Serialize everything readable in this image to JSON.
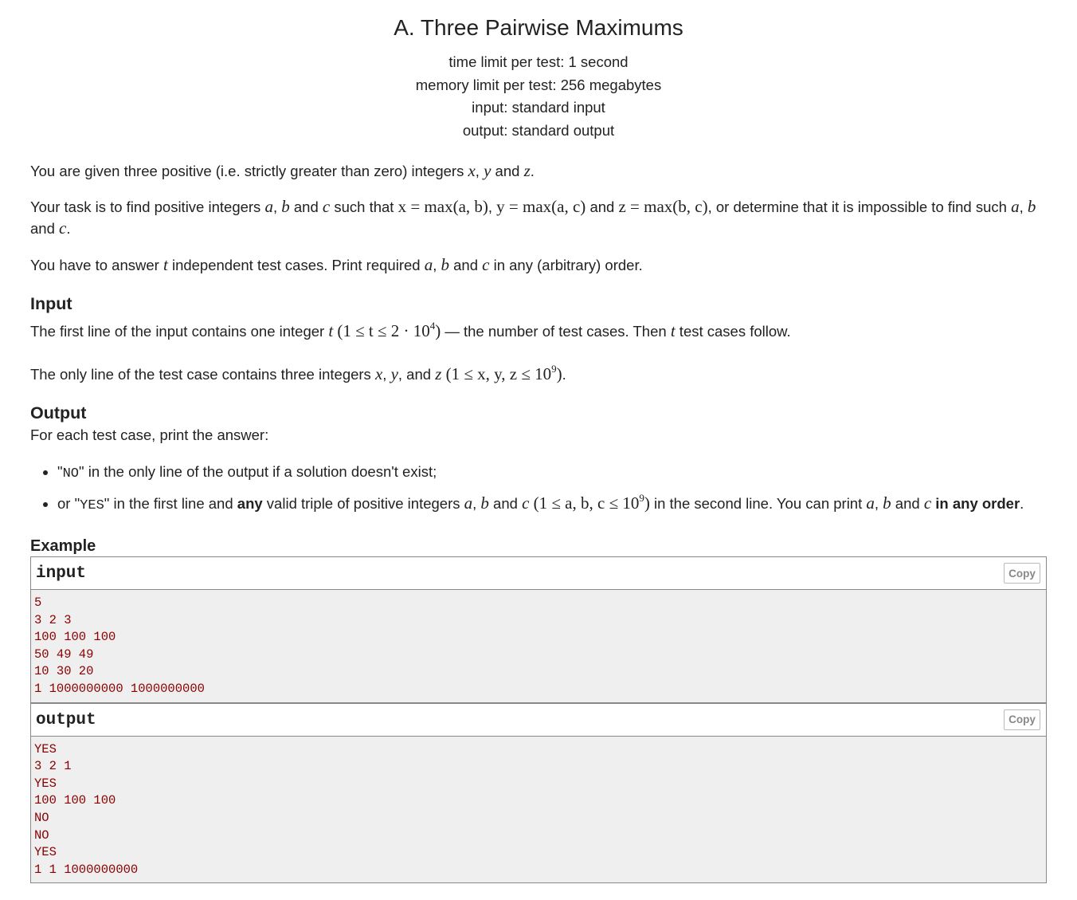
{
  "problem": {
    "title": "A. Three Pairwise Maximums",
    "limits": [
      "time limit per test: 1 second",
      "memory limit per test: 256 megabytes",
      "input: standard input",
      "output: standard output"
    ]
  },
  "statement": {
    "p1": {
      "a": "You are given three positive (i.e. strictly greater than zero) integers ",
      "x": "x",
      "c1": ", ",
      "y": "y",
      "and": " and ",
      "z": "z",
      "end": "."
    },
    "p2": {
      "a": "Your task is to find positive integers ",
      "v_a": "a",
      "c1": ", ",
      "v_b": "b",
      "and1": " and ",
      "v_c": "c",
      "such": " such that ",
      "eq1": "x = max(a, b)",
      "c2": ", ",
      "eq2": "y = max(a, c)",
      "and2": " and ",
      "eq3": "z = max(b, c)",
      "mid": ", or determine that it is impossible to find such ",
      "v_a2": "a",
      "c3": ", ",
      "v_b2": "b",
      "and3": " and ",
      "v_c2": "c",
      "end": "."
    },
    "p3": {
      "a": "You have to answer ",
      "t": "t",
      "b": " independent test cases. Print required ",
      "v_a": "a",
      "c1": ", ",
      "v_b": "b",
      "and": " and ",
      "v_c": "c",
      "end": " in any (arbitrary) order."
    }
  },
  "input_section": {
    "title": "Input",
    "p1": {
      "a": "The first line of the input contains one integer ",
      "t": "t",
      "range": "(1 ≤ t ≤ 2 · 10",
      "exp": "4",
      "close": ")",
      "b": " — the number of test cases. Then ",
      "t2": "t",
      "c": " test cases follow."
    },
    "p2": {
      "a": "The only line of the test case contains three integers ",
      "x": "x",
      "c1": ", ",
      "y": "y",
      "and": ", and ",
      "z": "z",
      "range": " (1 ≤ x, y, z ≤ 10",
      "exp": "9",
      "close": ")",
      "end": "."
    }
  },
  "output_section": {
    "title": "Output",
    "intro": "For each test case, print the answer:",
    "b1": {
      "q1": "\"",
      "code": "NO",
      "q2": "\"",
      "rest": " in the only line of the output if a solution doesn't exist;"
    },
    "b2": {
      "a": "or \"",
      "code": "YES",
      "b": "\" in the first line and ",
      "bold": "any",
      "c": " valid triple of positive integers ",
      "v_a": "a",
      "c1": ", ",
      "v_b": "b",
      "and1": " and ",
      "v_c": "c",
      "range": " (1 ≤ a, b, c ≤ 10",
      "exp": "9",
      "close": ")",
      "d": " in the second line. You can print ",
      "v_a2": "a",
      "c2": ", ",
      "v_b2": "b",
      "and2": " and ",
      "v_c2": "c",
      "bold2": " in any order",
      "end": "."
    }
  },
  "example": {
    "title": "Example",
    "input_label": "input",
    "output_label": "output",
    "copy_label": "Copy",
    "input_lines": [
      "5",
      "3 2 3",
      "100 100 100",
      "50 49 49",
      "10 30 20",
      "1 1000000000 1000000000"
    ],
    "output_lines": [
      "YES",
      "3 2 1",
      "YES",
      "100 100 100",
      "NO",
      "NO",
      "YES",
      "1 1 1000000000"
    ]
  }
}
